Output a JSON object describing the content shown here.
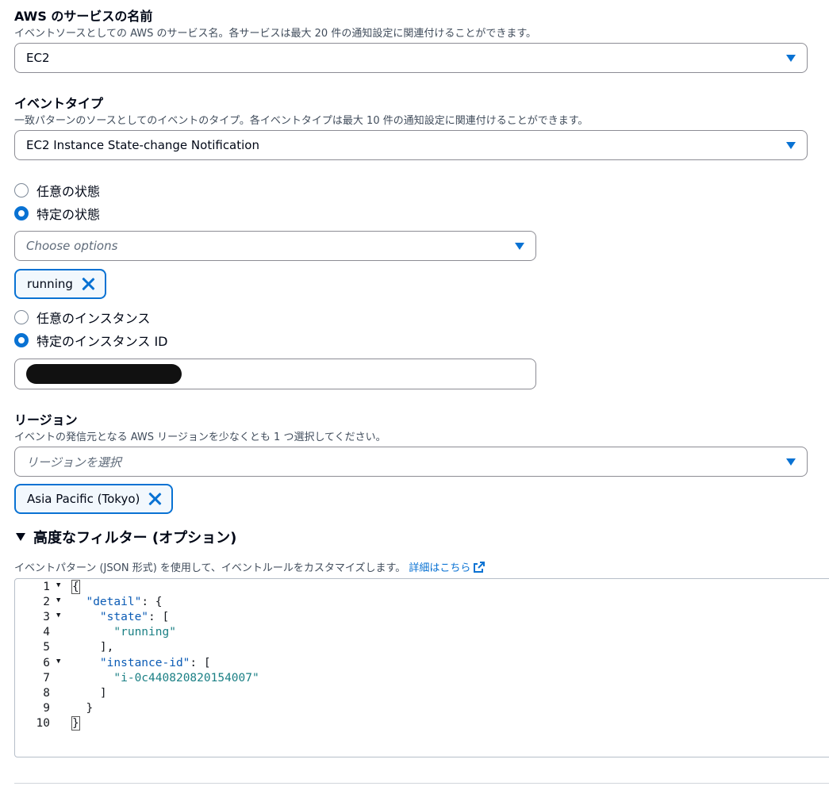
{
  "service": {
    "label": "AWS のサービスの名前",
    "description": "イベントソースとしての AWS のサービス名。各サービスは最大 20 件の通知設定に関連付けることができます。",
    "value": "EC2"
  },
  "event_type": {
    "label": "イベントタイプ",
    "description": "一致パターンのソースとしてのイベントのタイプ。各イベントタイプは最大 10 件の通知設定に関連付けることができます。",
    "value": "EC2 Instance State-change Notification"
  },
  "state": {
    "options": [
      {
        "label": "任意の状態",
        "checked": false
      },
      {
        "label": "特定の状態",
        "checked": true
      }
    ],
    "placeholder": "Choose options",
    "tokens": [
      "running"
    ]
  },
  "instance": {
    "options": [
      {
        "label": "任意のインスタンス",
        "checked": false
      },
      {
        "label": "特定のインスタンス ID",
        "checked": true
      }
    ]
  },
  "region": {
    "label": "リージョン",
    "description": "イベントの発信元となる AWS リージョンを少なくとも 1 つ選択してください。",
    "placeholder": "リージョンを選択",
    "tokens": [
      "Asia Pacific (Tokyo)"
    ]
  },
  "advanced": {
    "title": "高度なフィルター (オプション)",
    "description": "イベントパターン (JSON 形式) を使用して、イベントルールをカスタマイズします。",
    "link_text": "詳細はこちら"
  },
  "editor": {
    "line_numbers": [
      "1",
      "2",
      "3",
      "4",
      "5",
      "6",
      "7",
      "8",
      "9",
      "10"
    ],
    "lines": [
      [
        "{"
      ],
      [
        "  ",
        "\"detail\"",
        ": {"
      ],
      [
        "    ",
        "\"state\"",
        ": ["
      ],
      [
        "      ",
        "\"running\""
      ],
      [
        "    ],"
      ],
      [
        "    ",
        "\"instance-id\"",
        ": ["
      ],
      [
        "      ",
        "\"i-0c440820820154007\""
      ],
      [
        "    ]"
      ],
      [
        "  }"
      ],
      [
        "}"
      ]
    ]
  },
  "colors": {
    "accent": "#0972d3",
    "text": "#000716",
    "muted": "#414d5c"
  },
  "icons": [
    "caret-down-icon",
    "close-icon",
    "external-link-icon",
    "triangle-down-icon"
  ]
}
